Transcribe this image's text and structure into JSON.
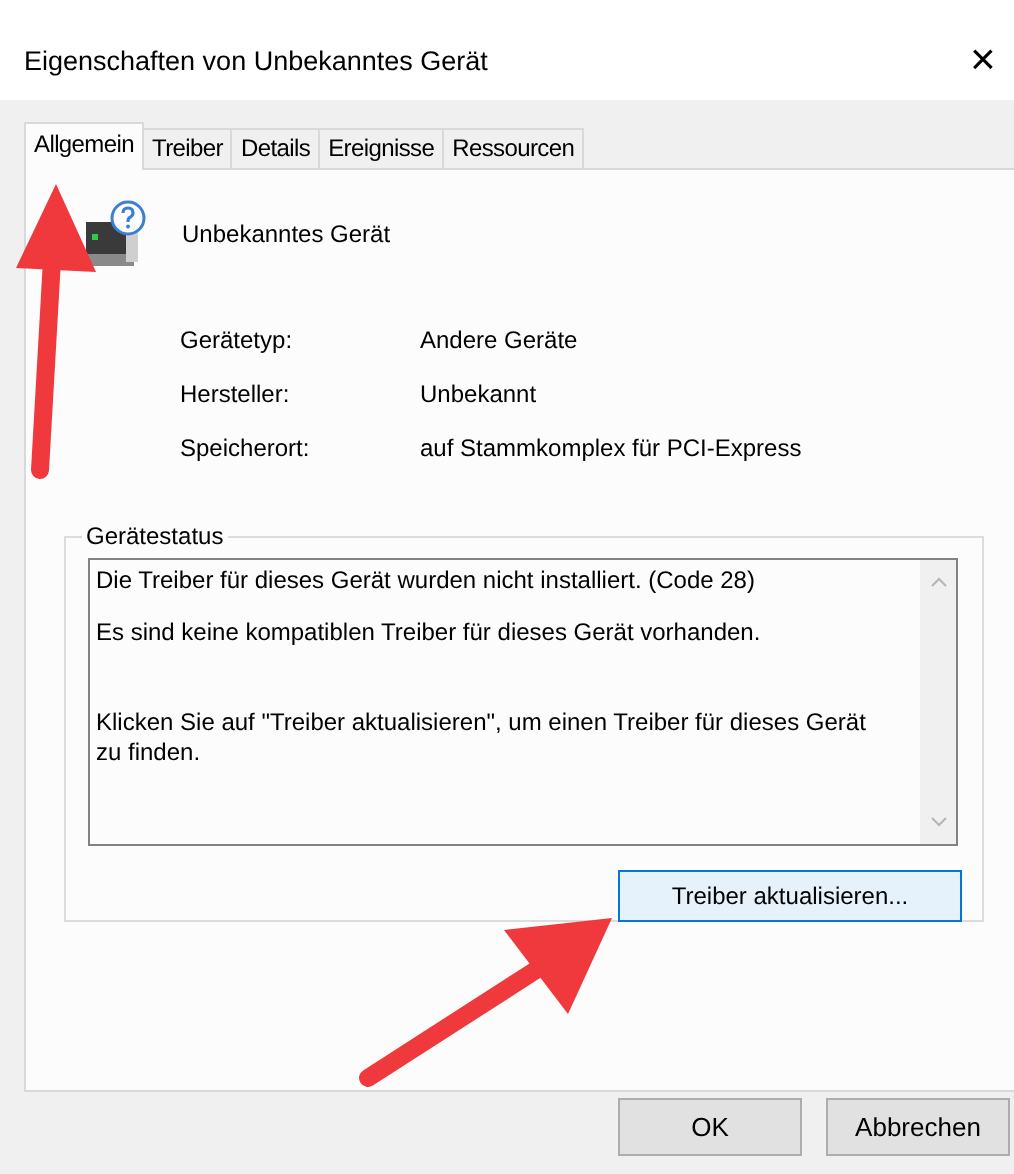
{
  "window": {
    "title": "Eigenschaften von Unbekanntes Gerät",
    "close": "×"
  },
  "tabs": [
    {
      "label": "Allgemein",
      "selected": true
    },
    {
      "label": "Treiber",
      "selected": false
    },
    {
      "label": "Details",
      "selected": false
    },
    {
      "label": "Ereignisse",
      "selected": false
    },
    {
      "label": "Ressourcen",
      "selected": false
    }
  ],
  "device": {
    "name": "Unbekanntes Gerät"
  },
  "properties": [
    {
      "label": "Gerätetyp:",
      "value": "Andere Geräte"
    },
    {
      "label": "Hersteller:",
      "value": "Unbekannt"
    },
    {
      "label": "Speicherort:",
      "value": "auf Stammkomplex für PCI-Express"
    }
  ],
  "status": {
    "legend": "Gerätestatus",
    "paragraphs": [
      "Die Treiber für dieses Gerät wurden nicht installiert. (Code 28)",
      "Es sind keine kompatiblen Treiber für dieses Gerät vorhanden.",
      "Klicken Sie auf \"Treiber aktualisieren\", um einen Treiber für dieses Gerät zu finden."
    ],
    "button": "Treiber aktualisieren..."
  },
  "buttons": [
    "OK",
    "Abbrechen"
  ]
}
